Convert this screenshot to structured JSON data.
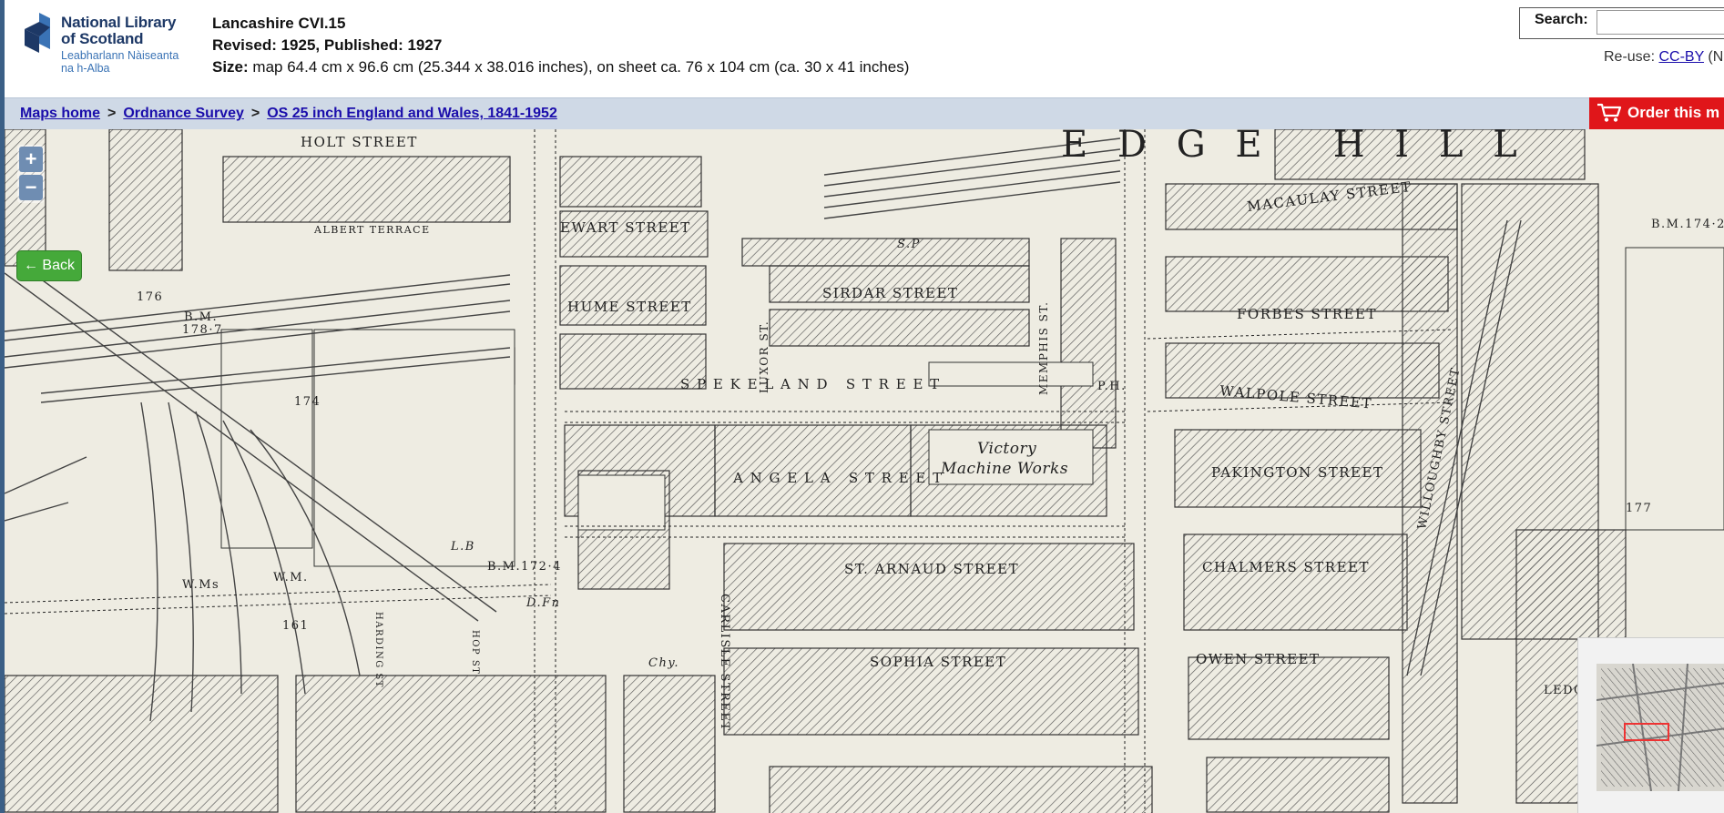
{
  "logo": {
    "line1": "National Library",
    "line2": "of Scotland",
    "line3": "Leabharlann Nàiseanta",
    "line4": "na h-Alba",
    "icon": "nls-logo-mark",
    "color_dark": "#1d3866",
    "color_light": "#3a73b5"
  },
  "map_info": {
    "title": "Lancashire CVI.15",
    "revised": "Revised: 1925, Published: 1927",
    "size_label": "Size:",
    "size_text": "map 64.4 cm x 96.6 cm (25.344 x 38.016 inches), on sheet ca. 76 x 104 cm (ca. 30 x 41 inches)"
  },
  "search": {
    "label": "Search:",
    "value": "",
    "placeholder": ""
  },
  "reuse": {
    "prefix": "Re-use: ",
    "link": "CC-BY",
    "suffix": " (NL"
  },
  "breadcrumb": {
    "items": [
      "Maps home",
      "Ordnance Survey",
      "OS 25 inch England and Wales, 1841-1952"
    ],
    "separator": ">"
  },
  "order_button": {
    "label": "Order this m",
    "icon": "cart-icon",
    "color": "#e0161a"
  },
  "map_controls": {
    "zoom_in": "+",
    "zoom_out": "−",
    "back": "← Back"
  },
  "map": {
    "labels": [
      "HOLT STREET",
      "ALBERT TERRACE",
      "EWART STREET",
      "HUME STREET",
      "SIRDAR STREET",
      "LUXOR ST.",
      "MEMPHIS ST.",
      "S P E K E L A N D   S T R E E T",
      "Victory",
      "Machine Works",
      "A N G E L A   S T R E E T",
      "ST. ARNAUD STREET",
      "CARLISLE STREET",
      "SOPHIA STREET",
      "MACAULAY STREET",
      "FORBES STREET",
      "WALPOLE STREET",
      "PAKINGTON STREET",
      "CHALMERS STREET",
      "OWEN STREET",
      "WILLOUGHBY STREET",
      "E D G E   H I L L",
      "B.M.",
      "178·7",
      "176",
      "174",
      "177",
      "B.M.174·2",
      "B.M.172·4",
      "161",
      "L.B",
      "W.M.",
      "W.Ms",
      "P.H.",
      "D.Fn",
      "Chy.",
      "S.P",
      "HARDING ST",
      "HOP ST",
      "LEDG"
    ],
    "paper_color": "#eeece2",
    "ink_color": "#2a2a2a"
  },
  "overview": {
    "frame_color": "#e33"
  }
}
